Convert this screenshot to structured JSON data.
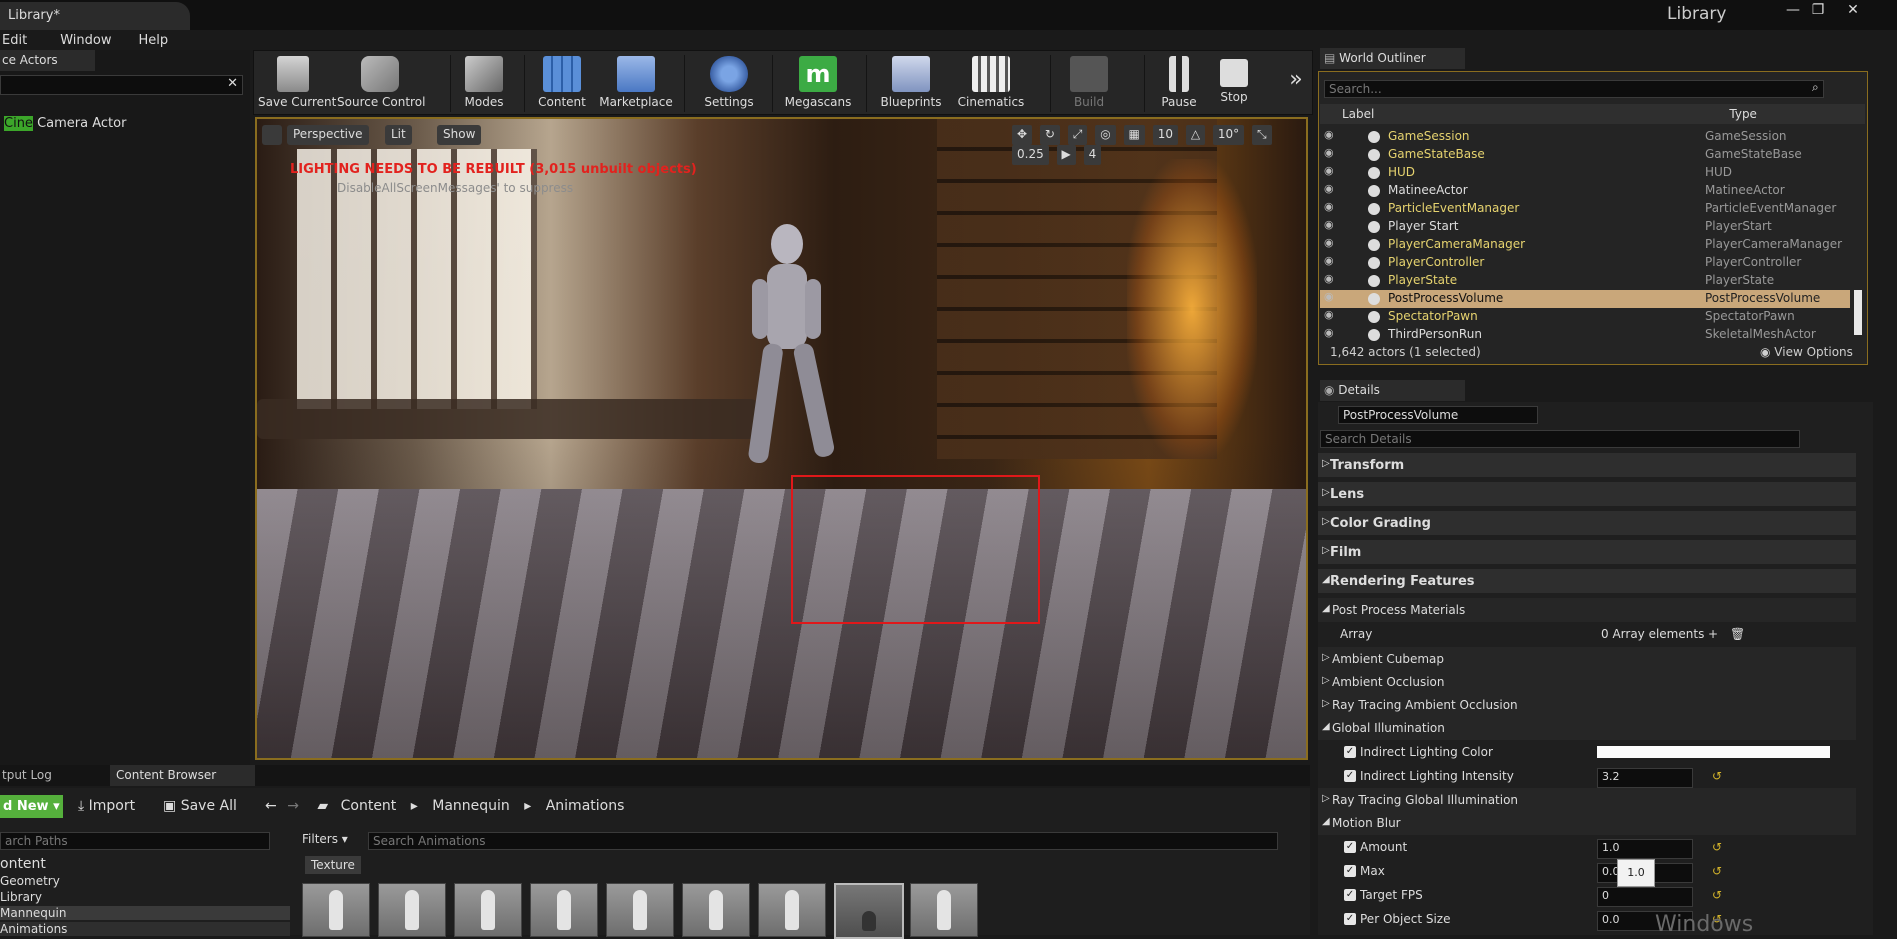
{
  "titlebar": {
    "doc_tab": "Library*",
    "window_title": "Library",
    "controls": [
      "—",
      "❐",
      "✕"
    ]
  },
  "menubar": [
    "Edit",
    "Window",
    "Help"
  ],
  "toolbar": {
    "buttons": [
      {
        "label": "Save Current",
        "icon": "save-icon"
      },
      {
        "label": "Source Control",
        "icon": "source-control-icon"
      },
      {
        "label": "Modes",
        "icon": "modes-icon"
      },
      {
        "label": "Content",
        "icon": "content-icon"
      },
      {
        "label": "Marketplace",
        "icon": "marketplace-icon"
      },
      {
        "label": "Settings",
        "icon": "settings-icon"
      },
      {
        "label": "Megascans",
        "icon": "megascans-icon"
      },
      {
        "label": "Blueprints",
        "icon": "blueprints-icon"
      },
      {
        "label": "Cinematics",
        "icon": "cinematics-icon"
      },
      {
        "label": "Build",
        "icon": "build-icon"
      },
      {
        "label": "Pause",
        "icon": "pause-icon"
      },
      {
        "label": "Stop",
        "icon": "stop-icon"
      }
    ],
    "overflow": "»"
  },
  "left_panel": {
    "tab": "ce Actors",
    "actor_prefix": "Cine",
    "actor_rest": " Camera Actor",
    "clear": "✕"
  },
  "viewport": {
    "perspective": "Perspective",
    "lit": "Lit",
    "show": "Show",
    "warning": "LIGHTING NEEDS TO BE REBUILT (3,015 unbuilt objects)",
    "subtext": "DisableAllScreenMessages' to suppress",
    "grid": "10",
    "rotation": "10°",
    "scale": "0.25",
    "camera_speed": "4"
  },
  "world_outliner": {
    "tab": "World Outliner",
    "search_placeholder": "Search...",
    "col_label": "Label",
    "col_type": "Type",
    "rows": [
      {
        "label": "GameSession",
        "type": "GameSession",
        "link": true,
        "selected": false
      },
      {
        "label": "GameStateBase",
        "type": "GameStateBase",
        "link": true,
        "selected": false
      },
      {
        "label": "HUD",
        "type": "HUD",
        "link": true,
        "selected": false
      },
      {
        "label": "MatineeActor",
        "type": "MatineeActor",
        "link": false,
        "selected": false
      },
      {
        "label": "ParticleEventManager",
        "type": "ParticleEventManager",
        "link": true,
        "selected": false
      },
      {
        "label": "Player Start",
        "type": "PlayerStart",
        "link": false,
        "selected": false
      },
      {
        "label": "PlayerCameraManager",
        "type": "PlayerCameraManager",
        "link": true,
        "selected": false
      },
      {
        "label": "PlayerController",
        "type": "PlayerController",
        "link": true,
        "selected": false
      },
      {
        "label": "PlayerState",
        "type": "PlayerState",
        "link": true,
        "selected": false
      },
      {
        "label": "PostProcessVolume",
        "type": "PostProcessVolume",
        "link": false,
        "selected": true
      },
      {
        "label": "SpectatorPawn",
        "type": "SpectatorPawn",
        "link": true,
        "selected": false
      },
      {
        "label": "ThirdPersonRun",
        "type": "SkeletalMeshActor",
        "link": false,
        "selected": false
      }
    ],
    "status": "1,642 actors (1 selected)",
    "view_options": "View Options"
  },
  "details": {
    "tab": "Details",
    "object_name": "PostProcessVolume",
    "search_placeholder": "Search Details",
    "rows": [
      {
        "kind": "cat",
        "label": "Transform"
      },
      {
        "kind": "cat",
        "label": "Lens"
      },
      {
        "kind": "cat",
        "label": "Color Grading"
      },
      {
        "kind": "cat",
        "label": "Film"
      },
      {
        "kind": "cat",
        "label": "Rendering Features"
      },
      {
        "kind": "sub",
        "label": "Post Process Materials"
      },
      {
        "kind": "prop",
        "label": "Array",
        "value": "0 Array elements"
      },
      {
        "kind": "sub",
        "label": "Ambient Cubemap"
      },
      {
        "kind": "sub",
        "label": "Ambient Occlusion"
      },
      {
        "kind": "sub",
        "label": "Ray Tracing Ambient Occlusion"
      },
      {
        "kind": "sub",
        "label": "Global Illumination"
      },
      {
        "kind": "check",
        "label": "Indirect Lighting Color"
      },
      {
        "kind": "check",
        "label": "Indirect Lighting Intensity",
        "value": "3.2"
      },
      {
        "kind": "sub",
        "label": "Ray Tracing Global Illumination"
      },
      {
        "kind": "sub",
        "label": "Motion Blur"
      },
      {
        "kind": "check",
        "label": "Amount",
        "value": "1.0"
      },
      {
        "kind": "check",
        "label": "Max",
        "value": "0.0"
      },
      {
        "kind": "check",
        "label": "Target FPS",
        "value": "0"
      },
      {
        "kind": "check",
        "label": "Per Object Size",
        "value": "0.0"
      }
    ],
    "tooltip": "1.0"
  },
  "content_browser": {
    "tab_log": "tput Log",
    "tab_browser": "Content Browser",
    "add_new": "d New ▾",
    "import": "Import",
    "save_all": "Save All",
    "crumbs": [
      "Content",
      "Mannequin",
      "Animations"
    ],
    "paths_placeholder": "arch Paths",
    "filters": "Filters ▾",
    "asset_search_placeholder": "Search Animations",
    "texture_filter": "Texture",
    "tree": [
      "ontent",
      "Geometry",
      "Library",
      "Mannequin",
      "Animations"
    ]
  },
  "watermark": "Windows"
}
